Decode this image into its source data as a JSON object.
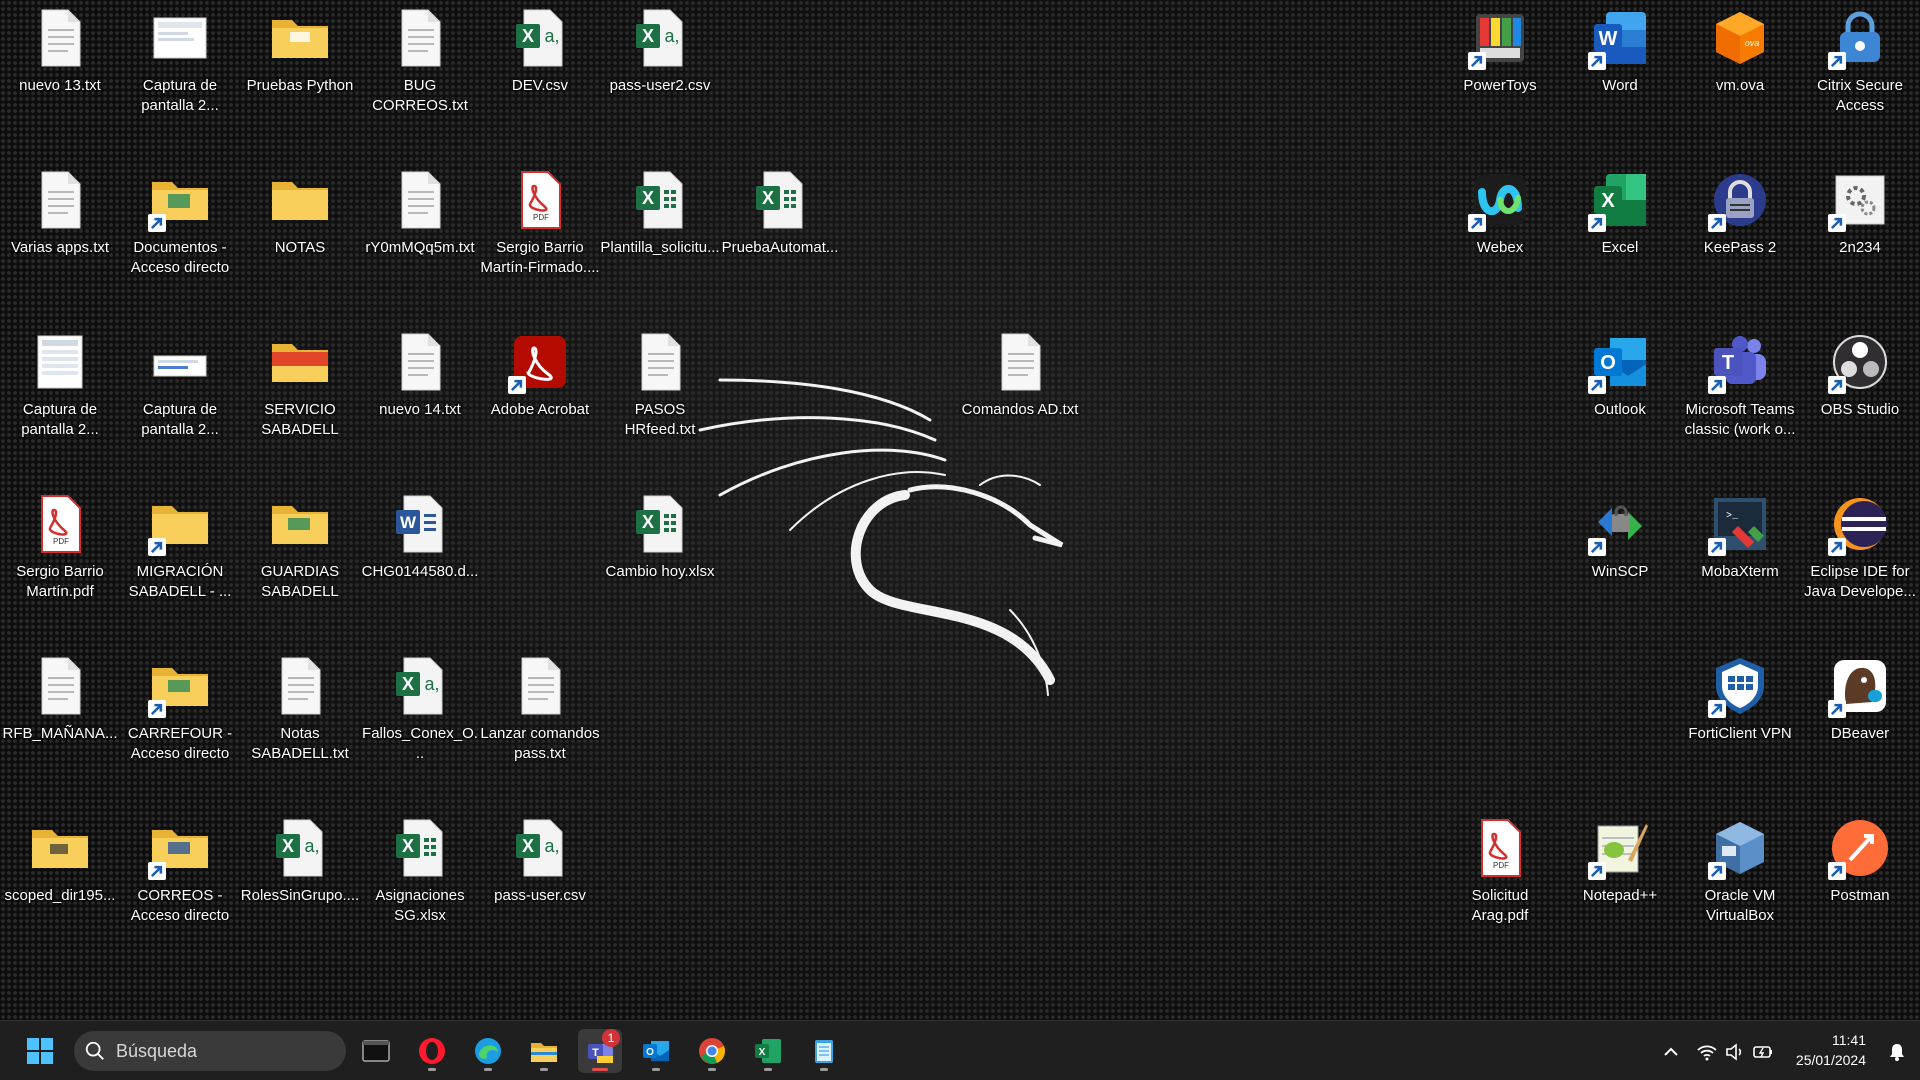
{
  "desktop": {
    "icons": [
      {
        "id": "d1",
        "label": "nuevo 13.txt",
        "icon": "text-file-icon"
      },
      {
        "id": "d2",
        "label": "Captura de\npantalla 2...",
        "icon": "image-file-icon"
      },
      {
        "id": "d3",
        "label": "Pruebas Python",
        "icon": "folder-icon"
      },
      {
        "id": "d4",
        "label": "BUG\nCORREOS.txt",
        "icon": "text-file-icon"
      },
      {
        "id": "d5",
        "label": "DEV.csv",
        "icon": "excel-csv-icon"
      },
      {
        "id": "d6",
        "label": "pass-user2.csv",
        "icon": "excel-csv-icon"
      },
      {
        "id": "d7",
        "label": "Varias apps.txt",
        "icon": "text-file-icon"
      },
      {
        "id": "d8",
        "label": "Documentos -\nAcceso directo",
        "icon": "folder-shortcut-icon"
      },
      {
        "id": "d9",
        "label": "NOTAS",
        "icon": "folder-icon"
      },
      {
        "id": "d10",
        "label": "rY0mMQq5m.txt",
        "icon": "text-file-icon"
      },
      {
        "id": "d11",
        "label": "Sergio Barrio\nMartín-Firmado....",
        "icon": "pdf-file-icon"
      },
      {
        "id": "d12",
        "label": "Plantilla_solicitu...",
        "icon": "excel-xlsx-icon"
      },
      {
        "id": "d13",
        "label": "PruebaAutomat...",
        "icon": "excel-xlsx-icon"
      },
      {
        "id": "d14",
        "label": "Captura de\npantalla 2...",
        "icon": "image-file-icon"
      },
      {
        "id": "d15",
        "label": "Captura de\npantalla 2...",
        "icon": "image-file-icon"
      },
      {
        "id": "d16",
        "label": "SERVICIO\nSABADELL",
        "icon": "folder-red-icon"
      },
      {
        "id": "d17",
        "label": "nuevo 14.txt",
        "icon": "text-file-icon"
      },
      {
        "id": "d18",
        "label": "Adobe Acrobat",
        "icon": "adobe-acrobat-icon"
      },
      {
        "id": "d19",
        "label": "PASOS\nHRfeed.txt",
        "icon": "text-file-icon"
      },
      {
        "id": "d20",
        "label": "Comandos AD.txt",
        "icon": "text-file-icon"
      },
      {
        "id": "d21",
        "label": "Sergio Barrio\nMartín.pdf",
        "icon": "pdf-file-icon"
      },
      {
        "id": "d22",
        "label": "MIGRACIÓN\nSABADELL - ...",
        "icon": "folder-shortcut-icon"
      },
      {
        "id": "d23",
        "label": "GUARDIAS\nSABADELL",
        "icon": "folder-icon"
      },
      {
        "id": "d24",
        "label": "CHG0144580.d...",
        "icon": "word-doc-icon"
      },
      {
        "id": "d25",
        "label": "Cambio hoy.xlsx",
        "icon": "excel-xlsx-icon"
      },
      {
        "id": "d26",
        "label": "RFB_MAÑANA...",
        "icon": "text-file-icon"
      },
      {
        "id": "d27",
        "label": "CARREFOUR -\nAcceso directo",
        "icon": "folder-shortcut-icon"
      },
      {
        "id": "d28",
        "label": "Notas\nSABADELL.txt",
        "icon": "text-file-icon"
      },
      {
        "id": "d29",
        "label": "Fallos_Conex_O...",
        "icon": "excel-csv-icon"
      },
      {
        "id": "d30",
        "label": "Lanzar comandos\npass.txt",
        "icon": "text-file-icon"
      },
      {
        "id": "d31",
        "label": "scoped_dir195...",
        "icon": "folder-icon"
      },
      {
        "id": "d32",
        "label": "CORREOS -\nAcceso directo",
        "icon": "folder-shortcut-icon"
      },
      {
        "id": "d33",
        "label": "RolesSinGrupo....",
        "icon": "excel-csv-icon"
      },
      {
        "id": "d34",
        "label": "Asignaciones\nSG.xlsx",
        "icon": "excel-xlsx-icon"
      },
      {
        "id": "d35",
        "label": "pass-user.csv",
        "icon": "excel-csv-icon"
      },
      {
        "id": "a1",
        "label": "PowerToys",
        "icon": "powertoys-icon"
      },
      {
        "id": "a2",
        "label": "Word",
        "icon": "word-app-icon"
      },
      {
        "id": "a3",
        "label": "vm.ova",
        "icon": "ova-package-icon"
      },
      {
        "id": "a4",
        "label": "Citrix Secure\nAccess",
        "icon": "citrix-lock-icon"
      },
      {
        "id": "a5",
        "label": "Webex",
        "icon": "webex-icon"
      },
      {
        "id": "a6",
        "label": "Excel",
        "icon": "excel-app-icon"
      },
      {
        "id": "a7",
        "label": "KeePass 2",
        "icon": "keepass-icon"
      },
      {
        "id": "a8",
        "label": "2n234",
        "icon": "settings-file-icon"
      },
      {
        "id": "a9",
        "label": "Outlook",
        "icon": "outlook-icon"
      },
      {
        "id": "a10",
        "label": "Microsoft Teams\nclassic (work o...",
        "icon": "teams-icon"
      },
      {
        "id": "a11",
        "label": "OBS Studio",
        "icon": "obs-icon"
      },
      {
        "id": "a12",
        "label": "WinSCP",
        "icon": "winscp-icon"
      },
      {
        "id": "a13",
        "label": "MobaXterm",
        "icon": "mobaxterm-icon"
      },
      {
        "id": "a14",
        "label": "Eclipse IDE for\nJava Develope...",
        "icon": "eclipse-icon"
      },
      {
        "id": "a15",
        "label": "FortiClient VPN",
        "icon": "forticlient-icon"
      },
      {
        "id": "a16",
        "label": "DBeaver",
        "icon": "dbeaver-icon"
      },
      {
        "id": "a17",
        "label": "Solicitud\nArag.pdf",
        "icon": "pdf-file-icon"
      },
      {
        "id": "a18",
        "label": "Notepad++",
        "icon": "notepadpp-icon"
      },
      {
        "id": "a19",
        "label": "Oracle VM\nVirtualBox",
        "icon": "virtualbox-icon"
      },
      {
        "id": "a20",
        "label": "Postman",
        "icon": "postman-icon"
      }
    ]
  },
  "taskbar": {
    "search_placeholder": "Búsqueda",
    "apps": [
      {
        "id": "terminal",
        "icon": "terminal-icon"
      },
      {
        "id": "opera",
        "icon": "opera-icon"
      },
      {
        "id": "edge",
        "icon": "edge-icon"
      },
      {
        "id": "explorer",
        "icon": "file-explorer-icon"
      },
      {
        "id": "teams",
        "icon": "teams-new-icon",
        "badge": "1"
      },
      {
        "id": "outlook",
        "icon": "outlook-icon"
      },
      {
        "id": "chrome",
        "icon": "chrome-icon"
      },
      {
        "id": "excel",
        "icon": "excel-icon"
      },
      {
        "id": "notepad",
        "icon": "notepad-icon"
      }
    ],
    "tray": {
      "time": "11:41",
      "date": "25/01/2024"
    }
  },
  "colors": {
    "excel_green": "#1d7044",
    "word_blue": "#2b579a",
    "pdf_red": "#d32f2f",
    "folder_yellow": "#f5c542",
    "taskbar_bg": "#1f1f1f",
    "notification_badge": "#d13438"
  }
}
